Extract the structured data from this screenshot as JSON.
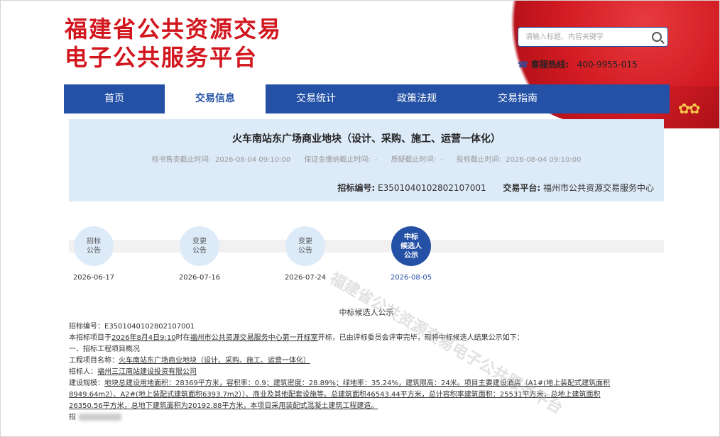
{
  "header": {
    "title_line1": "福建省公共资源交易",
    "title_line2": "电子公共服务平台",
    "search_placeholder": "请输入标题、内容关键字",
    "hotline_label": "客服热线:",
    "hotline_number": "400-9955-015"
  },
  "nav": {
    "items": [
      {
        "label": "首页"
      },
      {
        "label": "交易信息"
      },
      {
        "label": "交易统计"
      },
      {
        "label": "政策法规"
      },
      {
        "label": "交易指南"
      }
    ]
  },
  "project": {
    "title": "火车南站东广场商业地块（设计、采购、施工、运营一体化）",
    "meta": [
      {
        "label": "标书售卖截止时间:",
        "value": "2026-08-04 09:10:00"
      },
      {
        "label": "保证金缴纳截止时间:",
        "value": "-"
      },
      {
        "label": "质疑截止时间:",
        "value": "-"
      },
      {
        "label": "投标截止时间:",
        "value": "2026-08-04 09:10:00"
      }
    ],
    "code_label": "招标编号:",
    "code_value": "E3501040102802107001",
    "platform_label": "交易平台:",
    "platform_value": "福州市公共资源交易服务中心"
  },
  "timeline": [
    {
      "line1": "招标",
      "line2": "公告",
      "line3": "",
      "date": "2026-06-17"
    },
    {
      "line1": "变更",
      "line2": "公告",
      "line3": "",
      "date": "2026-07-16"
    },
    {
      "line1": "变更",
      "line2": "公告",
      "line3": "",
      "date": "2026-07-24"
    },
    {
      "line1": "中标",
      "line2": "候选人",
      "line3": "公示",
      "date": "2026-08-05"
    }
  ],
  "content": {
    "heading": "中标候选人公示",
    "line1": "招标编号：E3501040102802107001",
    "line2_a": "本招标项目于",
    "line2_date": "2026年8月4日9:10",
    "line2_b": "时在",
    "line2_place": "福州市公共资源交易服务中心第一开标室",
    "line2_c": "开标，已由评标委员会评审完毕，现将中标候选人结果公示如下：",
    "line3": "一、招标工程项目概况",
    "line4_label": "工程项目名称：",
    "line4_value": "火车南站东广场商业地块（设计、采购、施工、运营一体化）",
    "line5_label": "招标人：",
    "line5_value": "福州三江南站建设投资有限公司",
    "line6_label": "建设规模：",
    "line6_value": "地块总建设用地面积：28369平方米，容积率：0.9；建筑密度：28.89%；绿地率：35.24%，建筑限高：24米。项目主要建设酒店（A1#(地上装配式建筑面积",
    "line7": "8949.64m2）、A2#(地上装配式建筑面积6393.7m2））、商业及其他配套设施等。总建筑面积46543.44平方米，总计容积率建筑面积：25531平方米，总地上建筑面积",
    "line8": "26350.56平方米，总地下建筑面积为20192.88平方米，本项目采用装配式混凝土建筑工程建造。",
    "line9_label": "招"
  },
  "watermark": "福建省公共资源交易电子公共服务平台"
}
